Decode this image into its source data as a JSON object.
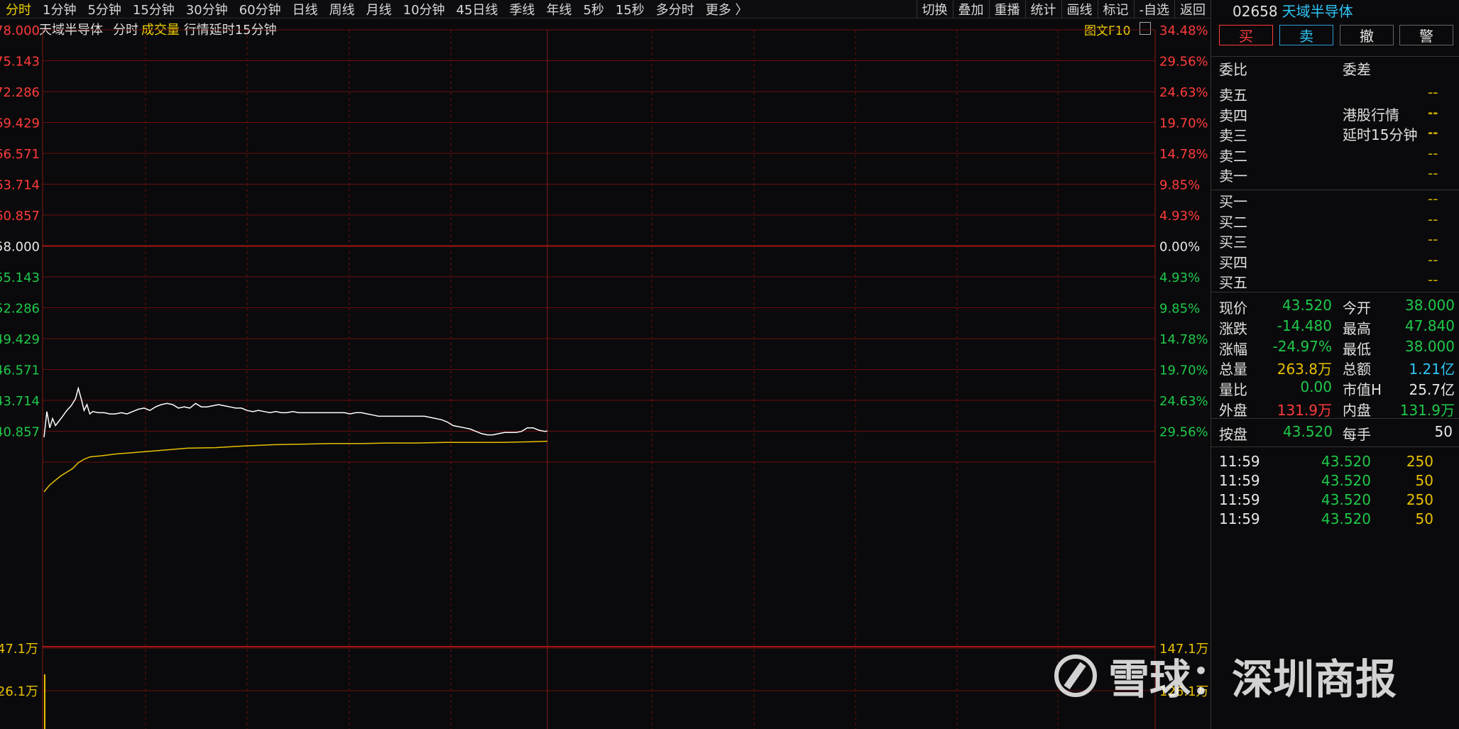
{
  "toolbar": {
    "tabs": [
      "分时",
      "1分钟",
      "5分钟",
      "15分钟",
      "30分钟",
      "60分钟",
      "日线",
      "周线",
      "月线",
      "10分钟",
      "45日线",
      "季线",
      "年线",
      "5秒",
      "15秒",
      "多分时",
      "更多 〉"
    ],
    "right_tools": [
      "切换",
      "叠加",
      "重播",
      "统计",
      "画线",
      "标记",
      "-自选",
      "返回"
    ]
  },
  "chart_header": {
    "stock_name": "天域半导体",
    "mode": "分时",
    "volume_label": "成交量",
    "delay_note": "行情延时15分钟",
    "f10_label": "图文F10"
  },
  "chart_data": {
    "type": "line",
    "y_ticks_price": [
      "78.000",
      "75.143",
      "72.286",
      "69.429",
      "66.571",
      "63.714",
      "60.857",
      "58.000",
      "55.143",
      "52.286",
      "49.429",
      "46.571",
      "43.714",
      "40.857"
    ],
    "y_ticks_pct": [
      "34.48%",
      "29.56%",
      "24.63%",
      "19.70%",
      "14.78%",
      "9.85%",
      "4.93%",
      "0.00%",
      "4.93%",
      "9.85%",
      "14.78%",
      "19.70%",
      "24.63%",
      "29.56%"
    ],
    "volume_ticks_left": [
      "147.1万",
      "126.1万"
    ],
    "volume_ticks_right": [
      "147.1万",
      "126.1万"
    ],
    "prev_close": 58.0,
    "ylim": [
      40.857,
      78.0
    ],
    "price_series": [
      [
        0,
        43.0
      ],
      [
        2,
        45.2
      ],
      [
        4,
        43.8
      ],
      [
        6,
        44.6
      ],
      [
        8,
        44.0
      ],
      [
        10,
        44.3
      ],
      [
        13,
        44.8
      ],
      [
        16,
        45.3
      ],
      [
        19,
        45.7
      ],
      [
        22,
        46.3
      ],
      [
        24,
        47.2
      ],
      [
        26,
        46.3
      ],
      [
        28,
        45.3
      ],
      [
        30,
        45.8
      ],
      [
        32,
        45.0
      ],
      [
        34,
        45.2
      ],
      [
        38,
        45.1
      ],
      [
        42,
        45.1
      ],
      [
        46,
        45.0
      ],
      [
        50,
        45.0
      ],
      [
        54,
        45.1
      ],
      [
        58,
        45.0
      ],
      [
        62,
        45.2
      ],
      [
        66,
        45.4
      ],
      [
        70,
        45.5
      ],
      [
        74,
        45.3
      ],
      [
        78,
        45.6
      ],
      [
        82,
        45.8
      ],
      [
        86,
        45.9
      ],
      [
        90,
        45.8
      ],
      [
        94,
        45.5
      ],
      [
        98,
        45.6
      ],
      [
        102,
        45.5
      ],
      [
        106,
        45.9
      ],
      [
        110,
        45.6
      ],
      [
        114,
        45.6
      ],
      [
        118,
        45.7
      ],
      [
        122,
        45.8
      ],
      [
        126,
        45.7
      ],
      [
        130,
        45.6
      ],
      [
        134,
        45.5
      ],
      [
        138,
        45.5
      ],
      [
        142,
        45.3
      ],
      [
        146,
        45.2
      ],
      [
        150,
        45.3
      ],
      [
        154,
        45.2
      ],
      [
        158,
        45.1
      ],
      [
        162,
        45.2
      ],
      [
        166,
        45.1
      ],
      [
        170,
        45.1
      ],
      [
        174,
        45.2
      ],
      [
        178,
        45.1
      ],
      [
        182,
        45.1
      ],
      [
        186,
        45.1
      ],
      [
        190,
        45.1
      ],
      [
        194,
        45.1
      ],
      [
        198,
        45.1
      ],
      [
        202,
        45.1
      ],
      [
        206,
        45.1
      ],
      [
        210,
        45.1
      ],
      [
        214,
        45.0
      ],
      [
        218,
        45.1
      ],
      [
        222,
        45.1
      ],
      [
        226,
        45.0
      ],
      [
        230,
        44.9
      ],
      [
        234,
        44.8
      ],
      [
        238,
        44.8
      ],
      [
        242,
        44.8
      ],
      [
        246,
        44.8
      ],
      [
        250,
        44.8
      ],
      [
        254,
        44.8
      ],
      [
        258,
        44.8
      ],
      [
        262,
        44.8
      ],
      [
        266,
        44.8
      ],
      [
        270,
        44.7
      ],
      [
        274,
        44.6
      ],
      [
        278,
        44.5
      ],
      [
        282,
        44.3
      ],
      [
        286,
        44.0
      ],
      [
        290,
        43.9
      ],
      [
        294,
        43.8
      ],
      [
        298,
        43.7
      ],
      [
        302,
        43.5
      ],
      [
        306,
        43.3
      ],
      [
        310,
        43.2
      ],
      [
        314,
        43.2
      ],
      [
        318,
        43.3
      ],
      [
        322,
        43.4
      ],
      [
        326,
        43.4
      ],
      [
        330,
        43.4
      ],
      [
        334,
        43.5
      ],
      [
        338,
        43.8
      ],
      [
        342,
        43.8
      ],
      [
        346,
        43.6
      ],
      [
        350,
        43.5
      ],
      [
        352,
        43.52
      ]
    ],
    "avg_series": [
      [
        0,
        38.3
      ],
      [
        4,
        38.9
      ],
      [
        8,
        39.3
      ],
      [
        12,
        39.7
      ],
      [
        16,
        40.0
      ],
      [
        20,
        40.3
      ],
      [
        24,
        40.8
      ],
      [
        28,
        41.1
      ],
      [
        32,
        41.3
      ],
      [
        40,
        41.4
      ],
      [
        50,
        41.55
      ],
      [
        60,
        41.65
      ],
      [
        70,
        41.75
      ],
      [
        80,
        41.85
      ],
      [
        90,
        41.95
      ],
      [
        100,
        42.05
      ],
      [
        120,
        42.1
      ],
      [
        140,
        42.25
      ],
      [
        160,
        42.35
      ],
      [
        180,
        42.4
      ],
      [
        200,
        42.45
      ],
      [
        220,
        42.45
      ],
      [
        240,
        42.5
      ],
      [
        260,
        42.5
      ],
      [
        280,
        42.55
      ],
      [
        300,
        42.55
      ],
      [
        320,
        42.55
      ],
      [
        340,
        42.6
      ],
      [
        352,
        42.65
      ]
    ],
    "x_max": 352,
    "volume_spike_value": 147.1
  },
  "panel": {
    "code": "02658",
    "name": "天域半导体",
    "buttons": [
      "买",
      "卖",
      "撤",
      "警"
    ],
    "weibi_label": "委比",
    "weicha_label": "委差",
    "sell_labels": [
      "卖五",
      "卖四",
      "卖三",
      "卖二",
      "卖一"
    ],
    "buy_labels": [
      "买一",
      "买二",
      "买三",
      "买四",
      "买五"
    ],
    "dash": "--",
    "hk_note": "港股行情",
    "delay_note": "延时15分钟",
    "stats": [
      {
        "l1": "现价",
        "v1": "43.520",
        "c1": "green",
        "l2": "今开",
        "v2": "38.000",
        "c2": "green"
      },
      {
        "l1": "涨跌",
        "v1": "-14.480",
        "c1": "green",
        "l2": "最高",
        "v2": "47.840",
        "c2": "green"
      },
      {
        "l1": "涨幅",
        "v1": "-24.97%",
        "c1": "green",
        "l2": "最低",
        "v2": "38.000",
        "c2": "green"
      },
      {
        "l1": "总量",
        "v1": "263.8万",
        "c1": "yellow",
        "l2": "总额",
        "v2": "1.21亿",
        "c2": "cyan"
      },
      {
        "l1": "量比",
        "v1": "0.00",
        "c1": "green",
        "l2": "市值H",
        "v2": "25.7亿",
        "c2": "white"
      },
      {
        "l1": "外盘",
        "v1": "131.9万",
        "c1": "red",
        "l2": "内盘",
        "v2": "131.9万",
        "c2": "green"
      }
    ],
    "anpan": {
      "l1": "按盘",
      "v1": "43.520",
      "l2": "每手",
      "v2": "50"
    },
    "ticks": [
      {
        "time": "11:59",
        "price": "43.520",
        "vol": "250"
      },
      {
        "time": "11:59",
        "price": "43.520",
        "vol": "50"
      },
      {
        "time": "11:59",
        "price": "43.520",
        "vol": "250"
      },
      {
        "time": "11:59",
        "price": "43.520",
        "vol": "50"
      }
    ]
  },
  "watermark": {
    "text": "雪球：深圳商报"
  },
  "colors": {
    "grid": "#6b0d0d",
    "price_line": "#ffffff",
    "avg_line": "#e8c000",
    "up": "#ff3b3b",
    "down": "#1fc94a"
  }
}
